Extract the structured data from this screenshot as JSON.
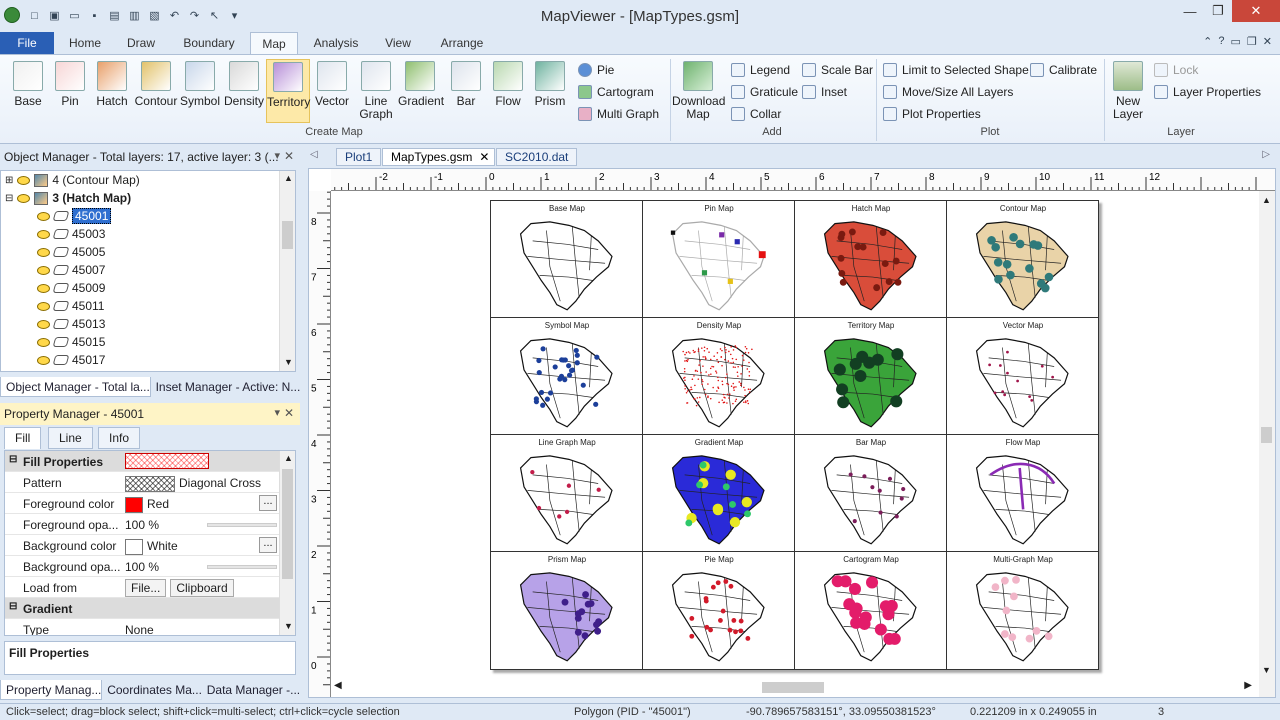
{
  "window": {
    "title": "MapViewer - [MapTypes.gsm]"
  },
  "ribbon_tabs": [
    "File",
    "Home",
    "Draw",
    "Boundary",
    "Map",
    "Analysis",
    "View",
    "Arrange"
  ],
  "create_map": {
    "buttons": [
      {
        "label": "Base",
        "icon": "base-map-icon"
      },
      {
        "label": "Pin",
        "icon": "pin-map-icon"
      },
      {
        "label": "Hatch",
        "icon": "hatch-map-icon"
      },
      {
        "label": "Contour",
        "icon": "contour-map-icon"
      },
      {
        "label": "Symbol",
        "icon": "symbol-map-icon"
      },
      {
        "label": "Density",
        "icon": "density-map-icon"
      },
      {
        "label": "Territory",
        "icon": "territory-map-icon"
      },
      {
        "label": "Vector",
        "icon": "vector-map-icon"
      },
      {
        "label": "Line Graph",
        "icon": "line-graph-map-icon"
      },
      {
        "label": "Gradient",
        "icon": "gradient-map-icon"
      },
      {
        "label": "Bar",
        "icon": "bar-map-icon"
      },
      {
        "label": "Flow",
        "icon": "flow-map-icon"
      },
      {
        "label": "Prism",
        "icon": "prism-map-icon"
      }
    ],
    "small": [
      "Pie",
      "Cartogram",
      "Multi Graph"
    ],
    "label": "Create Map"
  },
  "add_group": {
    "download": "Download Map",
    "items": [
      "Legend",
      "Scale Bar",
      "Graticule",
      "Inset",
      "Collar"
    ],
    "label": "Add"
  },
  "plot_group": {
    "items": [
      "Limit to Selected Shape",
      "Calibrate",
      "Move/Size All Layers",
      "Plot Properties"
    ],
    "label": "Plot"
  },
  "layer_group": {
    "new_layer": "New Layer",
    "items": [
      "Lock",
      "Layer Properties"
    ],
    "label": "Layer"
  },
  "object_manager": {
    "title": "Object Manager - Total layers: 17, active layer: 3 (...",
    "layers": [
      {
        "label": "4 (Contour Map)"
      },
      {
        "label": "3 (Hatch Map)"
      }
    ],
    "items": [
      "45001",
      "45003",
      "45005",
      "45007",
      "45009",
      "45011",
      "45013",
      "45015",
      "45017"
    ],
    "tabs": [
      "Object Manager - Total la...",
      "Inset Manager - Active: N..."
    ]
  },
  "property_manager": {
    "title": "Property Manager - 45001",
    "tabs": [
      "Fill",
      "Line",
      "Info"
    ],
    "sections": {
      "fill": "Fill Properties",
      "gradient": "Gradient"
    },
    "rows": {
      "pattern": {
        "key": "Pattern",
        "value": "Diagonal Cross"
      },
      "fg_color": {
        "key": "Foreground color",
        "value": "Red",
        "hex": "#ff0000"
      },
      "fg_opacity": {
        "key": "Foreground opa...",
        "value": "100 %"
      },
      "bg_color": {
        "key": "Background color",
        "value": "White",
        "hex": "#ffffff"
      },
      "bg_opacity": {
        "key": "Background opa...",
        "value": "100 %"
      },
      "load_from": {
        "key": "Load from",
        "file": "File...",
        "clipboard": "Clipboard"
      },
      "type": {
        "key": "Type",
        "value": "None"
      }
    },
    "description": "Fill Properties",
    "bottom_tabs": [
      "Property Manag...",
      "Coordinates Ma...",
      "Data Manager -..."
    ]
  },
  "doc_tabs": [
    "Plot1",
    "MapTypes.gsm",
    "SC2010.dat"
  ],
  "ruler": {
    "h_labels": [
      "-2",
      "-1",
      "0",
      "1",
      "2",
      "3",
      "4",
      "5",
      "6",
      "7",
      "8",
      "9",
      "10",
      "11",
      "12"
    ],
    "v_labels": [
      "8",
      "7",
      "6",
      "5",
      "4",
      "3",
      "2",
      "1",
      "0"
    ]
  },
  "maps": [
    {
      "title": "Base Map",
      "style": "base"
    },
    {
      "title": "Pin Map",
      "style": "pin"
    },
    {
      "title": "Hatch Map",
      "style": "hatch"
    },
    {
      "title": "Contour Map",
      "style": "contour"
    },
    {
      "title": "Symbol Map",
      "style": "symbol"
    },
    {
      "title": "Density Map",
      "style": "density"
    },
    {
      "title": "Territory Map",
      "style": "territory"
    },
    {
      "title": "Vector Map",
      "style": "vector"
    },
    {
      "title": "Line Graph Map",
      "style": "linegraph"
    },
    {
      "title": "Gradient Map",
      "style": "gradient"
    },
    {
      "title": "Bar Map",
      "style": "bar"
    },
    {
      "title": "Flow Map",
      "style": "flow"
    },
    {
      "title": "Prism Map",
      "style": "prism"
    },
    {
      "title": "Pie Map",
      "style": "pie"
    },
    {
      "title": "Cartogram Map",
      "style": "cartogram"
    },
    {
      "title": "Multi-Graph Map",
      "style": "multigraph"
    }
  ],
  "status": {
    "hint": "Click=select; drag=block select; shift+click=multi-select; ctrl+click=cycle selection",
    "object": "Polygon (PID - \"45001\")",
    "coords": "-90.789657583151°, 33.09550381523°",
    "size": "0.221209 in x 0.249055 in",
    "count": "3"
  }
}
